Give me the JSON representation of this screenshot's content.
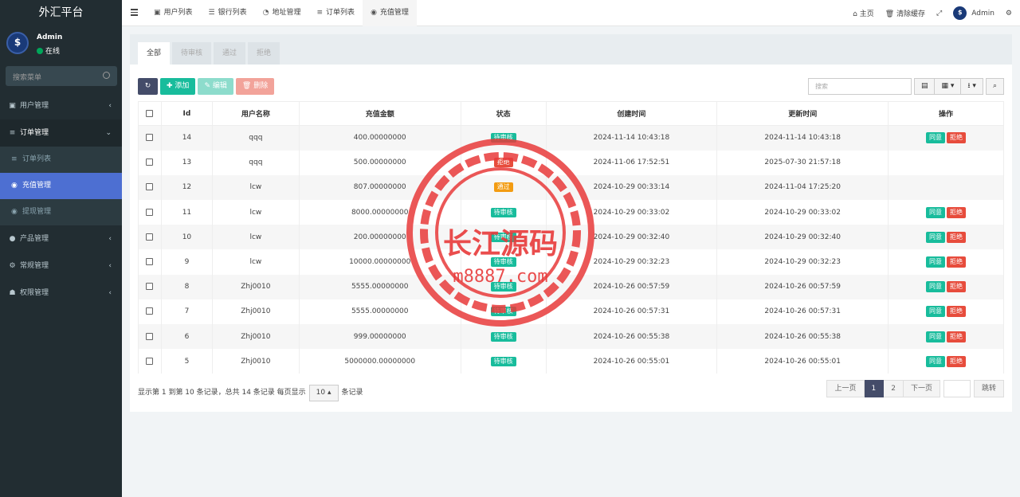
{
  "brand": "外汇平台",
  "user": {
    "name": "Admin",
    "status": "在线"
  },
  "sidebar_search_placeholder": "搜索菜单",
  "menu": {
    "user_mgmt": "用户管理",
    "order_mgmt": "订单管理",
    "order_list": "订单列表",
    "recharge_mgmt": "充值管理",
    "withdraw_mgmt": "提现管理",
    "product_mgmt": "产品管理",
    "general_mgmt": "常规管理",
    "perm_mgmt": "权限管理"
  },
  "top_tabs": [
    "用户列表",
    "银行列表",
    "地址管理",
    "订单列表",
    "充值管理"
  ],
  "top_right": {
    "home": "主页",
    "clear_cache": "清除缓存",
    "admin": "Admin"
  },
  "panel_tabs": [
    "全部",
    "待审核",
    "通过",
    "拒绝"
  ],
  "toolbar": {
    "add": "添加",
    "edit": "编辑",
    "delete": "删除",
    "search_placeholder": "搜索"
  },
  "columns": [
    "Id",
    "用户名称",
    "充值金额",
    "状态",
    "创建时间",
    "更新时间",
    "操作"
  ],
  "rows": [
    {
      "id": "14",
      "user": "qqq",
      "amount": "400.00000000",
      "status": "待审核",
      "status_type": "pending",
      "created": "2024-11-14 10:43:18",
      "updated": "2024-11-14 10:43:18",
      "actions": true
    },
    {
      "id": "13",
      "user": "qqq",
      "amount": "500.00000000",
      "status": "拒绝",
      "status_type": "reject",
      "created": "2024-11-06 17:52:51",
      "updated": "2025-07-30 21:57:18",
      "actions": false
    },
    {
      "id": "12",
      "user": "lcw",
      "amount": "807.00000000",
      "status": "通过",
      "status_type": "pass",
      "created": "2024-10-29 00:33:14",
      "updated": "2024-11-04 17:25:20",
      "actions": false
    },
    {
      "id": "11",
      "user": "lcw",
      "amount": "8000.00000000",
      "status": "待审核",
      "status_type": "pending",
      "created": "2024-10-29 00:33:02",
      "updated": "2024-10-29 00:33:02",
      "actions": true
    },
    {
      "id": "10",
      "user": "lcw",
      "amount": "200.00000000",
      "status": "待审核",
      "status_type": "pending",
      "created": "2024-10-29 00:32:40",
      "updated": "2024-10-29 00:32:40",
      "actions": true
    },
    {
      "id": "9",
      "user": "lcw",
      "amount": "10000.00000000",
      "status": "待审核",
      "status_type": "pending",
      "created": "2024-10-29 00:32:23",
      "updated": "2024-10-29 00:32:23",
      "actions": true
    },
    {
      "id": "8",
      "user": "Zhj0010",
      "amount": "5555.00000000",
      "status": "待审核",
      "status_type": "pending",
      "created": "2024-10-26 00:57:59",
      "updated": "2024-10-26 00:57:59",
      "actions": true
    },
    {
      "id": "7",
      "user": "Zhj0010",
      "amount": "5555.00000000",
      "status": "待审核",
      "status_type": "pending",
      "created": "2024-10-26 00:57:31",
      "updated": "2024-10-26 00:57:31",
      "actions": true
    },
    {
      "id": "6",
      "user": "Zhj0010",
      "amount": "999.00000000",
      "status": "待审核",
      "status_type": "pending",
      "created": "2024-10-26 00:55:38",
      "updated": "2024-10-26 00:55:38",
      "actions": true
    },
    {
      "id": "5",
      "user": "Zhj0010",
      "amount": "5000000.00000000",
      "status": "待审核",
      "status_type": "pending",
      "created": "2024-10-26 00:55:01",
      "updated": "2024-10-26 00:55:01",
      "actions": true
    }
  ],
  "row_actions": {
    "agree": "同意",
    "deny": "拒绝"
  },
  "footer": {
    "summary": "显示第 1 到第 10 条记录，总共 14 条记录 每页显示",
    "page_size": "10",
    "suffix": "条记录"
  },
  "pager": {
    "prev": "上一页",
    "pages": [
      "1",
      "2"
    ],
    "next": "下一页",
    "jump": "跳转"
  },
  "watermark": {
    "text": "长江源码",
    "url": "m8887.com"
  },
  "colors": {
    "sidebar": "#222d32",
    "active": "#4d6fd2",
    "success": "#18bc9c",
    "danger": "#e74c3c",
    "warning": "#f39c12"
  }
}
